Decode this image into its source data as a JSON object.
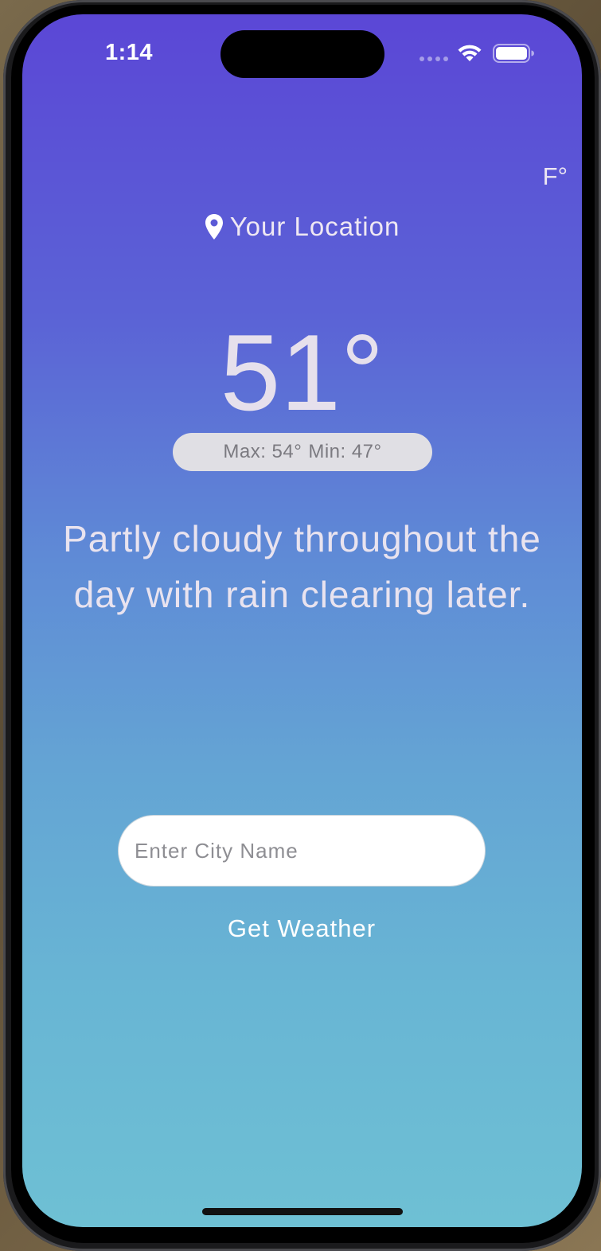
{
  "status_bar": {
    "time": "1:14",
    "icons": [
      "cellular-signal-icon",
      "wifi-icon",
      "battery-icon"
    ]
  },
  "unit_toggle": {
    "label": "F°"
  },
  "location": {
    "icon": "location-pin-icon",
    "label": "Your Location"
  },
  "weather": {
    "temperature": "51°",
    "max": "Max: 54°",
    "min": "Min: 47°",
    "description": "Partly cloudy throughout the day with rain clearing later."
  },
  "search": {
    "placeholder": "Enter City Name",
    "value": "",
    "button_label": "Get Weather"
  },
  "colors": {
    "gradient_top": "#5b47d6",
    "gradient_bottom": "#6ec0d4",
    "pill_background": "#e0dfe4",
    "text_light": "#e9e3ef"
  }
}
